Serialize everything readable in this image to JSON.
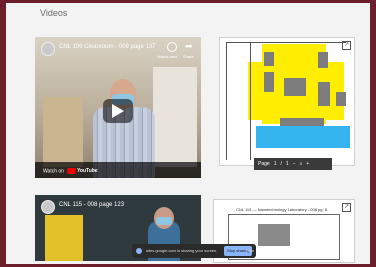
{
  "section": {
    "title": "Videos"
  },
  "videos": [
    {
      "title": "CNL 106 Cleanroom - 009 page 137",
      "watch_later": "Watch later",
      "share": "Share",
      "watch_on": "Watch on",
      "platform": "YouTube"
    },
    {
      "title": "CNL 115 - 008 page 123"
    }
  ],
  "maps": [
    {
      "toolbar": {
        "page_label": "Page",
        "page_current": "1",
        "page_sep": "/",
        "page_total": "1",
        "zoom_out": "−",
        "zoom_icon": "⌕",
        "zoom_in": "+"
      }
    },
    {
      "title": "CNL 115 — Nanotechnology Laboratory - 008 pg. 8"
    }
  ],
  "toast": {
    "text": "sites.google.com is sharing your screen.",
    "stop_label": "Stop sharing",
    "hide_label": "Hide"
  },
  "colors": {
    "frame": "#6b1f2a",
    "map_yellow": "#ffee00",
    "map_blue": "#33b4ee"
  }
}
